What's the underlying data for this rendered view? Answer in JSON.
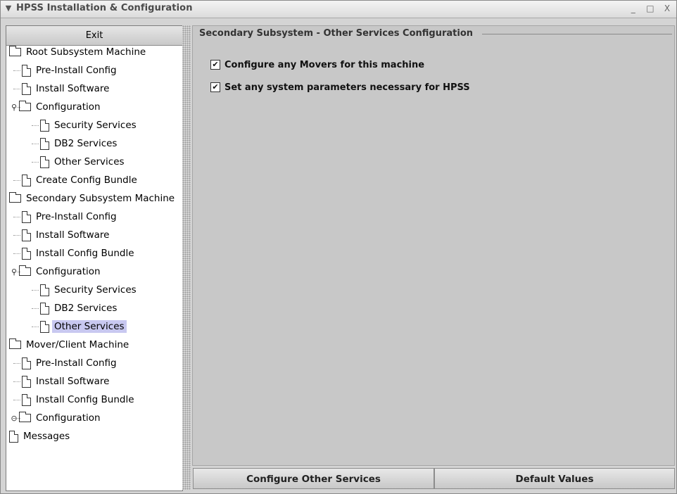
{
  "window": {
    "title": "HPSS Installation & Configuration",
    "controls": [
      "_",
      "□",
      "X"
    ]
  },
  "left_panel": {
    "exit_label": "Exit",
    "tree": [
      {
        "label": "Root Subsystem Machine",
        "icon": "folder-icon",
        "level": 0
      },
      {
        "label": "Pre-Install Config",
        "icon": "document-icon",
        "level": 1
      },
      {
        "label": "Install Software",
        "icon": "document-icon",
        "level": 1
      },
      {
        "label": "Configuration",
        "icon": "folder-icon",
        "level": 1,
        "expanded": true
      },
      {
        "label": "Security Services",
        "icon": "document-icon",
        "level": 2
      },
      {
        "label": "DB2 Services",
        "icon": "document-icon",
        "level": 2
      },
      {
        "label": "Other Services",
        "icon": "document-icon",
        "level": 2
      },
      {
        "label": "Create Config Bundle",
        "icon": "document-icon",
        "level": 1
      },
      {
        "label": "Secondary Subsystem Machine",
        "icon": "folder-icon",
        "level": 0
      },
      {
        "label": "Pre-Install Config",
        "icon": "document-icon",
        "level": 1
      },
      {
        "label": "Install Software",
        "icon": "document-icon",
        "level": 1
      },
      {
        "label": "Install Config Bundle",
        "icon": "document-icon",
        "level": 1
      },
      {
        "label": "Configuration",
        "icon": "folder-icon",
        "level": 1,
        "expanded": true
      },
      {
        "label": "Security Services",
        "icon": "document-icon",
        "level": 2
      },
      {
        "label": "DB2 Services",
        "icon": "document-icon",
        "level": 2
      },
      {
        "label": "Other Services",
        "icon": "document-icon",
        "level": 2,
        "selected": true
      },
      {
        "label": "Mover/Client Machine",
        "icon": "folder-icon",
        "level": 0
      },
      {
        "label": "Pre-Install Config",
        "icon": "document-icon",
        "level": 1
      },
      {
        "label": "Install Software",
        "icon": "document-icon",
        "level": 1
      },
      {
        "label": "Install Config Bundle",
        "icon": "document-icon",
        "level": 1
      },
      {
        "label": "Configuration",
        "icon": "folder-icon",
        "level": 1,
        "expanded": false
      },
      {
        "label": "Messages",
        "icon": "document-icon",
        "level": 0
      }
    ]
  },
  "main": {
    "group_title": "Secondary Subsystem - Other Services Configuration",
    "options": [
      {
        "label": "Configure any Movers for this machine",
        "checked": true
      },
      {
        "label": "Set any system parameters necessary for HPSS",
        "checked": true
      }
    ],
    "buttons": {
      "configure_label": "Configure Other Services",
      "defaults_label": "Default Values"
    }
  },
  "colors": {
    "selection": "#c8c8f0",
    "panel_bg": "#c8c8c8"
  }
}
